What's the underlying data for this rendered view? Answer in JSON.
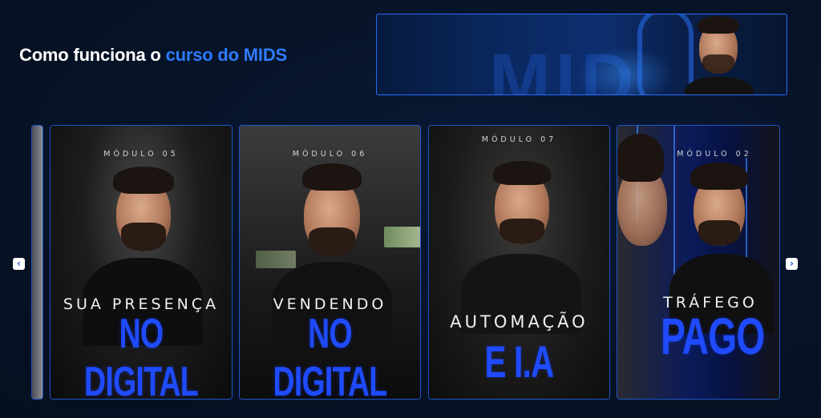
{
  "section": {
    "title_prefix": "Como funciona o ",
    "title_accent": "curso do MIDS"
  },
  "banner": {
    "watermark": "MID",
    "image_desc": "person-portrait"
  },
  "carousel": {
    "prev_icon": "chevron-left-icon",
    "next_icon": "chevron-right-icon",
    "prev_glyph": "‹",
    "next_glyph": "›",
    "cards": [
      {
        "module": "MÓDULO 05",
        "line1": "SUA PRESENÇA",
        "line2": "NO DIGITAL"
      },
      {
        "module": "MÓDULO 06",
        "line1": "VENDENDO",
        "line2": "NO DIGITAL"
      },
      {
        "module": "MÓDULO 07",
        "line1": "AUTOMAÇÃO",
        "line2": "E I.A"
      },
      {
        "module": "MÓDULO 02",
        "line1": "TRÁFEGO",
        "line2": "PAGO"
      }
    ]
  },
  "colors": {
    "background": "#061226",
    "accent": "#2f7bff",
    "card_title_blue": "#1f4bff",
    "card_border": "#1f56c8"
  }
}
